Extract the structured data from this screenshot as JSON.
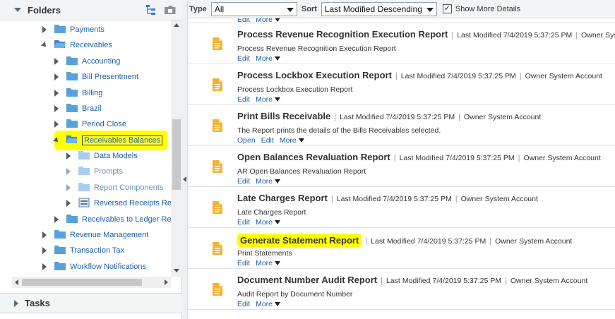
{
  "folders_panel": {
    "title": "Folders",
    "tree": [
      {
        "label": "Payments"
      },
      {
        "label": "Receivables"
      },
      {
        "label": "Accounting"
      },
      {
        "label": "Bill Presentment"
      },
      {
        "label": "Billing"
      },
      {
        "label": "Brazil"
      },
      {
        "label": "Period Close"
      },
      {
        "label": "Receivables Balances"
      },
      {
        "label": "Data Models"
      },
      {
        "label": "Prompts"
      },
      {
        "label": "Report Components"
      },
      {
        "label": "Reversed Receipts Rep"
      },
      {
        "label": "Receivables to Ledger Rec"
      },
      {
        "label": "Revenue Management"
      },
      {
        "label": "Transaction Tax"
      },
      {
        "label": "Workflow Notifications"
      }
    ]
  },
  "tasks_panel": {
    "title": "Tasks"
  },
  "toolbar": {
    "type_label": "Type",
    "type_value": "All",
    "sort_label": "Sort",
    "sort_value": "Last Modified Descending",
    "show_more_label": "Show More Details",
    "show_more_checked": true
  },
  "reports": [
    {
      "name": "Process Revenue Recognition Execution Report",
      "modified_label": "Last Modified",
      "modified": "7/4/2019 5:37:25 PM",
      "owner_label": "Owner",
      "owner": "System Account",
      "description": "Process Revenue Recognition Execution Report",
      "actions": [
        "Edit",
        "More"
      ]
    },
    {
      "name": "Process Lockbox Execution Report",
      "modified_label": "Last Modified",
      "modified": "7/4/2019 5:37:25 PM",
      "owner_label": "Owner",
      "owner": "System Account",
      "description": "Process Lockbox Execution Report",
      "actions": [
        "Edit",
        "More"
      ]
    },
    {
      "name": "Print Bills Receivable",
      "modified_label": "Last Modified",
      "modified": "7/4/2019 5:37:25 PM",
      "owner_label": "Owner",
      "owner": "System Account",
      "description": "The Report prints the details of the Bills Receivables selected.",
      "actions": [
        "Open",
        "Edit",
        "More"
      ]
    },
    {
      "name": "Open Balances Revaluation Report",
      "modified_label": "Last Modified",
      "modified": "7/4/2019 5:37:25 PM",
      "owner_label": "Owner",
      "owner": "System Account",
      "description": "AR Open Balances Revaluation Report",
      "actions": [
        "Edit",
        "More"
      ]
    },
    {
      "name": "Late Charges Report",
      "modified_label": "Last Modified",
      "modified": "7/4/2019 5:37:25 PM",
      "owner_label": "Owner",
      "owner": "System Account",
      "description": "Late Charges Report",
      "actions": [
        "Edit",
        "More"
      ]
    },
    {
      "name": "Generate Statement Report",
      "modified_label": "Last Modified",
      "modified": "7/4/2019 5:37:25 PM",
      "owner_label": "Owner",
      "owner": "System Account",
      "description": "Print Statements",
      "actions": [
        "Edit",
        "More"
      ]
    },
    {
      "name": "Document Number Audit Report",
      "modified_label": "Last Modified",
      "modified": "7/4/2019 5:37:25 PM",
      "owner_label": "Owner",
      "owner": "System Account",
      "description": "Audit Report by Document Number",
      "actions": [
        "Edit",
        "More"
      ]
    }
  ],
  "partial_row_actions": [
    "Edit",
    "More"
  ],
  "colors": {
    "highlight": "#ffff00",
    "link": "#1f5fa8",
    "folder": "#5aa0dc",
    "doc_icon": "#f5b335"
  }
}
